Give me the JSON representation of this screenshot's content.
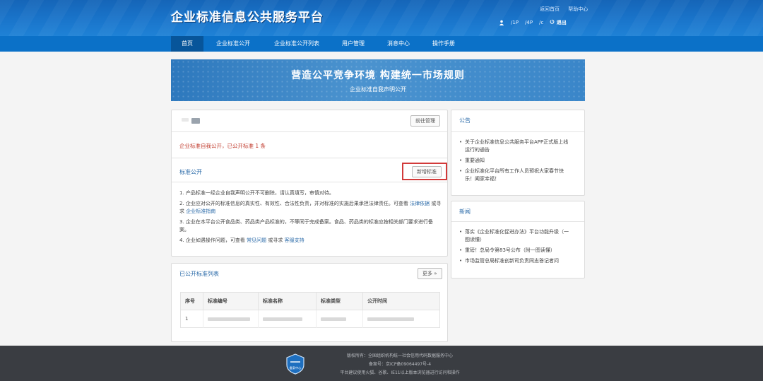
{
  "header": {
    "site_title": "企业标准信息公共服务平台",
    "links": [
      "返回首页",
      "帮助中心"
    ],
    "user_items": [
      "/1P",
      "/4P",
      "/c"
    ],
    "logout": "退出"
  },
  "nav": {
    "items": [
      "首页",
      "企业标准公开",
      "企业标准公开列表",
      "用户管理",
      "消息中心",
      "操作手册"
    ]
  },
  "banner": {
    "title": "营造公平竞争环境  构建统一市场规则",
    "subtitle": "企业标准自我声明公开"
  },
  "info_panel": {
    "manage_button": "前往管理",
    "notice": "企业标准自我公开，已公开标准 1 条"
  },
  "standards_panel": {
    "title": "标准公开",
    "new_button": "新增标准",
    "rules": [
      {
        "n": "1.",
        "text": "产品标准一经企业自我声明公开不可删除，请认真填写，审慎对待。"
      },
      {
        "n": "2.",
        "text": "企业应对公开的标准信息的真实性、有效性、合法性负责，并对标准的实施后果承担法律责任。可查看",
        "link1": "法律依据",
        "mid": "或寻求",
        "link2": "企业标准指南"
      },
      {
        "n": "3.",
        "text": "企业在本平台公开食品类、药品类产品标准的，不等同于完成备案。食品、药品类的标准应按相关部门要求进行备案。"
      },
      {
        "n": "4.",
        "text": "企业如遇操作问题，可查看",
        "link1": "常见问题",
        "mid": "或寻求",
        "link2": "客服支持"
      }
    ]
  },
  "published_panel": {
    "title": "已公开标准列表",
    "more_button": "更多 »",
    "columns": [
      "序号",
      "标准编号",
      "标准名称",
      "标准类型",
      "公开时间"
    ],
    "rows": [
      [
        "1",
        "",
        "",
        "",
        ""
      ]
    ]
  },
  "announcements": {
    "title": "公告",
    "items": [
      "关于企业标准信息公共服务平台APP正式版上线运行的通告",
      "重要通知",
      "企业标准化平台所有工作人员预祝大家春节快乐！阖家幸福！"
    ]
  },
  "news": {
    "title": "新闻",
    "items": [
      "落实《企业标准化促进办法》平台功能升级（一图读懂）",
      "重磅！总局令第83号公布（附一图读懂）",
      "市场监管总局标准创新司负责同志答记者问"
    ]
  },
  "footer": {
    "lines": [
      "版权所有：全国组织机构统一社会信用代码数据服务中心",
      "备案号：京ICP备09064497号-4",
      "平台建议使用火狐、谷歌、IE11以上版本浏览器进行访问和操作"
    ],
    "badge_text": "备案中心"
  },
  "colors": {
    "header_blue": "#1a76cc",
    "nav_blue": "#0b71c8",
    "nav_active": "#07559a",
    "notice_red": "#c0392b",
    "link_blue": "#2a6aa8",
    "highlight_red": "#d23a3a",
    "footer_dark": "#3a3d42"
  }
}
